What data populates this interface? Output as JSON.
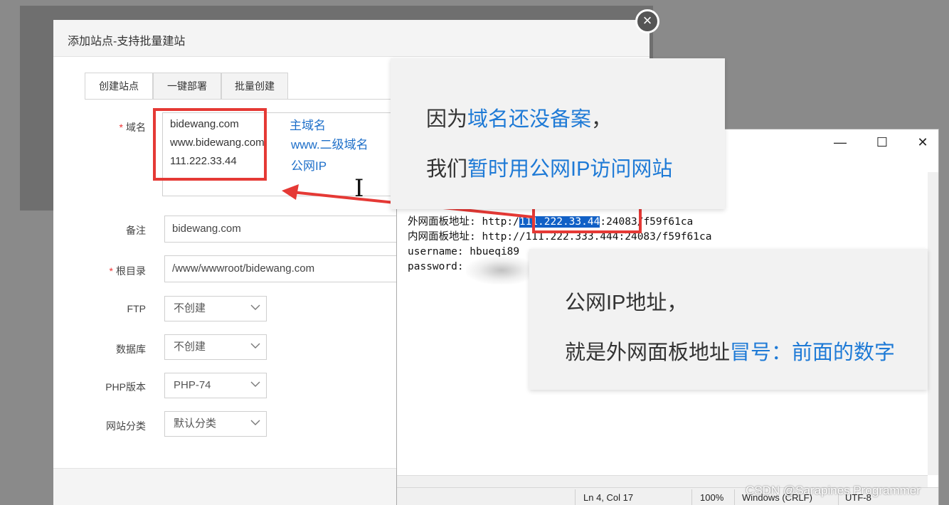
{
  "dialog": {
    "title": "添加站点-支持批量建站",
    "tabs": [
      {
        "label": "创建站点",
        "active": true
      },
      {
        "label": "一键部署",
        "active": false
      },
      {
        "label": "批量创建",
        "active": false
      }
    ],
    "domain_label": "域名",
    "domain_lines": [
      "bidewang.com",
      "www.bidewang.com",
      "111.222.33.44"
    ],
    "remark_label": "备注",
    "remark_value": "bidewang.com",
    "root_label": "根目录",
    "root_value": "/www/wwwroot/bidewang.com",
    "ftp_label": "FTP",
    "ftp_value": "不创建",
    "db_label": "数据库",
    "db_value": "不创建",
    "php_label": "PHP版本",
    "php_value": "PHP-74",
    "category_label": "网站分类",
    "category_value": "默认分类",
    "close_glyph": "×"
  },
  "annotations": {
    "main_domain": "主域名",
    "www_subdomain": "www.二级域名",
    "public_ip": "公网IP"
  },
  "caption_top": {
    "line1_a": "因为",
    "line1_b": "域名还没备案",
    "line1_c": "，",
    "line2_a": "我们",
    "line2_b": "暂时用公网IP访问网站"
  },
  "caption_bottom": {
    "line1": "公网IP地址，",
    "line2_a": "就是外网面板地址",
    "line2_b": "冒号：前面的数字"
  },
  "notepad": {
    "min_glyph": "—",
    "max_glyph": "☐",
    "close_glyph": "✕",
    "line1_prefix": "外网面板地址: http:/",
    "line1_slash": "/",
    "line1_selected": "111.222.33.44",
    "line1_suffix": ":24083/f59f61ca",
    "line2": "内网面板地址: http://111.222.333.444:24083/f59f61ca",
    "line3": "username: hbueqi89",
    "line4": "password:",
    "status_pos": "Ln 4, Col 17",
    "status_zoom": "100%",
    "status_eol": "Windows (CRLF)",
    "status_enc": "UTF-8"
  },
  "watermark": "CSDN @Sarapines Programmer",
  "colors": {
    "accent_blue": "#1e7ad6",
    "highlight_red": "#e53935",
    "selection_blue": "#1160c6"
  }
}
